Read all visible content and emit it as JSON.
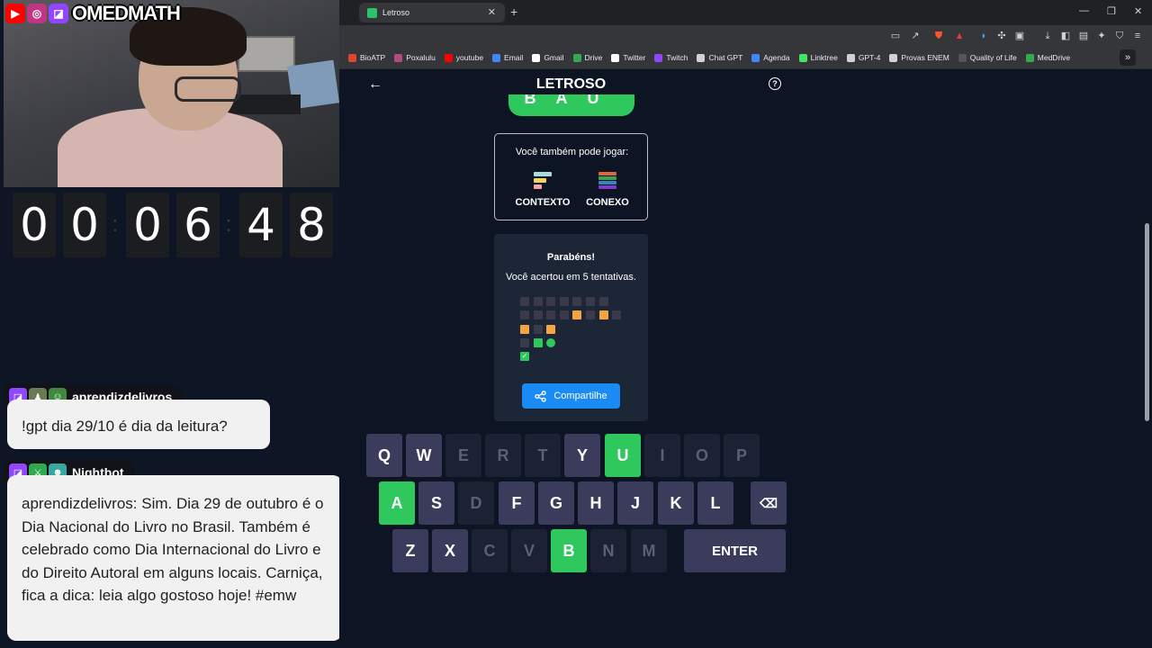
{
  "social": {
    "name": "OMEDMATH",
    "icons": [
      "youtube-icon",
      "instagram-icon",
      "twitch-icon"
    ]
  },
  "timer": {
    "digits": [
      "0",
      "0",
      "0",
      "6",
      "4",
      "8"
    ]
  },
  "chat": [
    {
      "user": "aprendizdelivros",
      "message": "!gpt dia 29/10 é dia da leitura?"
    },
    {
      "user": "Nightbot",
      "message": "aprendizdelivros: Sim. Dia 29 de outubro é o Dia Nacional do Livro no Brasil. Também é celebrado como Dia Internacional do Livro e do Direito Autoral em alguns locais. Carniça, fica a dica: leia algo gostoso hoje! #emw"
    }
  ],
  "browser": {
    "tab_title": "Letroso",
    "bookmarks": [
      {
        "label": "BioATP",
        "color": "#e0452f"
      },
      {
        "label": "Poxalulu",
        "color": "#b34b7d"
      },
      {
        "label": "youtube",
        "color": "#ff0000"
      },
      {
        "label": "Email",
        "color": "#4285f4"
      },
      {
        "label": "Gmail",
        "color": "#ffffff"
      },
      {
        "label": "Drive",
        "color": "#34a853"
      },
      {
        "label": "Twitter",
        "color": "#ffffff"
      },
      {
        "label": "Twitch",
        "color": "#9146ff"
      },
      {
        "label": "Chat GPT",
        "color": "#cfd1d4"
      },
      {
        "label": "Agenda",
        "color": "#4285f4"
      },
      {
        "label": "Linktree",
        "color": "#43e660"
      },
      {
        "label": "GPT-4",
        "color": "#cfd1d4"
      },
      {
        "label": "Provas ENEM",
        "color": "#cfd1d4"
      },
      {
        "label": "Quality of Life",
        "color": "#555555"
      },
      {
        "label": "MedDrive",
        "color": "#34a853"
      }
    ]
  },
  "game": {
    "title": "LETROSO",
    "solved_word": "BAU",
    "other_games_title": "Você também pode jogar:",
    "other_games": [
      "CONTEXTO",
      "CONEXO"
    ],
    "congrats": "Parabéns!",
    "attempts_text": "Você acertou em 5 tentativas.",
    "share_label": "Compartilhe",
    "result_grid": [
      [
        "a",
        "a",
        "a",
        "a",
        "a",
        "a",
        "a"
      ],
      [
        "a",
        "a",
        "a",
        "a",
        "y",
        "a",
        "y",
        "a"
      ],
      [
        "y",
        "a",
        "y"
      ],
      [
        "a",
        "g",
        "gc"
      ],
      [
        "gk"
      ]
    ],
    "keyboard": [
      [
        {
          "k": "Q",
          "s": "normal"
        },
        {
          "k": "W",
          "s": "normal"
        },
        {
          "k": "E",
          "s": "absent"
        },
        {
          "k": "R",
          "s": "absent"
        },
        {
          "k": "T",
          "s": "absent"
        },
        {
          "k": "Y",
          "s": "normal"
        },
        {
          "k": "U",
          "s": "green"
        },
        {
          "k": "I",
          "s": "absent"
        },
        {
          "k": "O",
          "s": "absent"
        },
        {
          "k": "P",
          "s": "absent"
        }
      ],
      [
        {
          "k": "A",
          "s": "green"
        },
        {
          "k": "S",
          "s": "normal"
        },
        {
          "k": "D",
          "s": "absent"
        },
        {
          "k": "F",
          "s": "normal"
        },
        {
          "k": "G",
          "s": "normal"
        },
        {
          "k": "H",
          "s": "normal"
        },
        {
          "k": "J",
          "s": "normal"
        },
        {
          "k": "K",
          "s": "normal"
        },
        {
          "k": "L",
          "s": "normal"
        },
        {
          "k": "⌫",
          "s": "normal"
        }
      ],
      [
        {
          "k": "Z",
          "s": "normal"
        },
        {
          "k": "X",
          "s": "normal"
        },
        {
          "k": "C",
          "s": "absent"
        },
        {
          "k": "V",
          "s": "absent"
        },
        {
          "k": "B",
          "s": "green"
        },
        {
          "k": "N",
          "s": "absent"
        },
        {
          "k": "M",
          "s": "absent"
        },
        {
          "k": "ENTER",
          "s": "normal"
        }
      ]
    ]
  },
  "colors": {
    "green": "#2ec85d",
    "yellow": "#f5a443",
    "absent": "#3a3a4a",
    "share": "#1a8bf5"
  }
}
